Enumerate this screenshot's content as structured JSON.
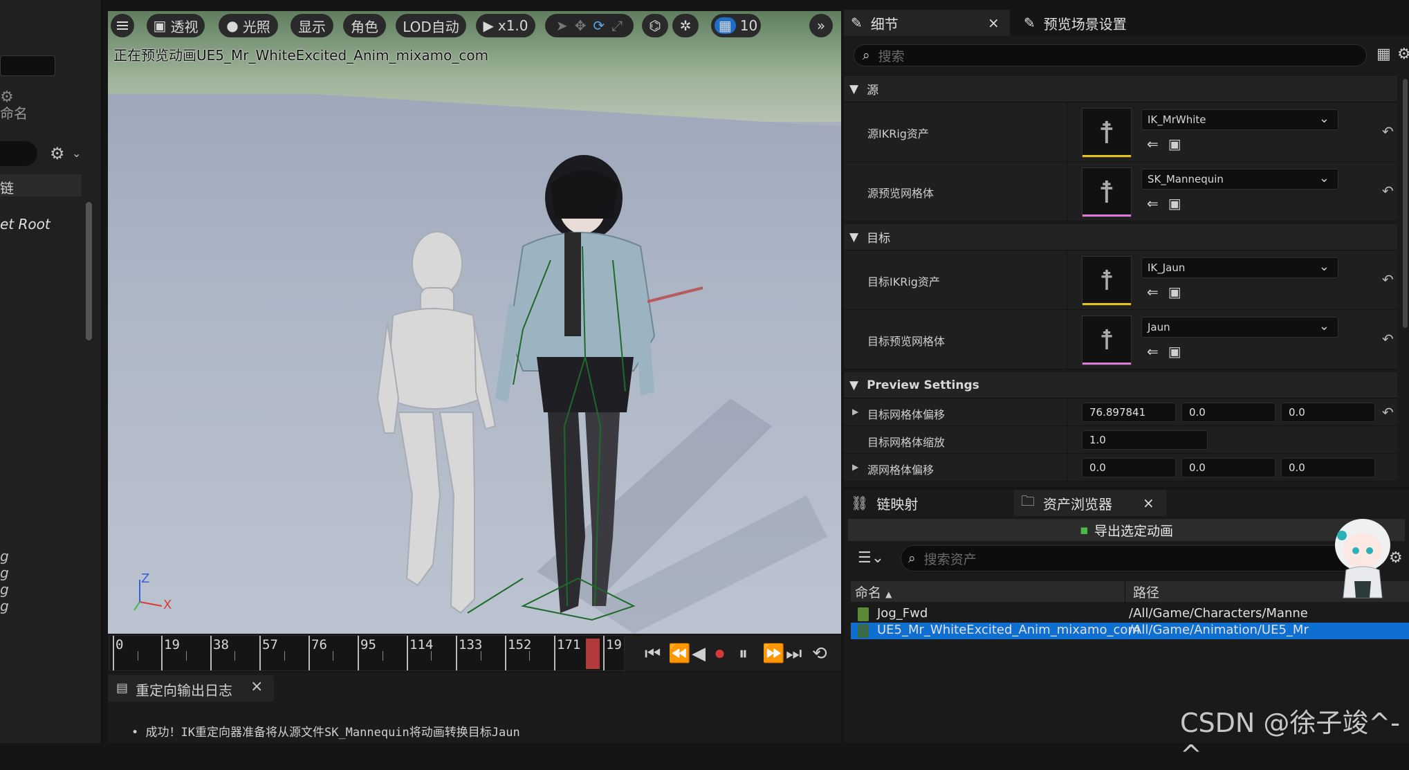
{
  "left": {
    "name_label": "命名",
    "chain_label": "链",
    "root_label": "et Root",
    "items": [
      "g",
      "g",
      "g",
      "g"
    ]
  },
  "viewport": {
    "menu_icon": "hamburger-icon",
    "perspective": "透视",
    "lighting": "光照",
    "show": "显示",
    "character": "角色",
    "lod": "LOD自动",
    "play_speed": "x1.0",
    "grid_value": "10",
    "preview_label": "正在预览动画UE5_Mr_WhiteExcited_Anim_mixamo_com",
    "axis_z": "Z",
    "axis_x": "X"
  },
  "timeline": {
    "ticks": [
      "0",
      "19",
      "38",
      "57",
      "76",
      "95",
      "114",
      "133",
      "152",
      "171",
      "19"
    ]
  },
  "log": {
    "tab_label": "重定向输出日志",
    "message": "成功！IK重定向器准备将从源文件SK_Mannequin将动画转换目标Jaun"
  },
  "details": {
    "tab_details": "细节",
    "tab_preview_settings": "预览场景设置",
    "search_placeholder": "搜索",
    "section_source": "源",
    "source_ik_label": "源IKRig资产",
    "source_ik_value": "IK_MrWhite",
    "source_mesh_label": "源预览网格体",
    "source_mesh_value": "SK_Mannequin",
    "section_target": "目标",
    "target_ik_label": "目标IKRig资产",
    "target_ik_value": "IK_Jaun",
    "target_mesh_label": "目标预览网格体",
    "target_mesh_value": "Jaun",
    "section_preview": "Preview Settings",
    "target_offset_label": "目标网格体偏移",
    "target_offset": [
      "76.897841",
      "0.0",
      "0.0"
    ],
    "target_scale_label": "目标网格体缩放",
    "target_scale": "1.0",
    "source_offset_label": "源网格体偏移",
    "source_offset": [
      "0.0",
      "0.0",
      "0.0"
    ]
  },
  "bottom": {
    "tab_chain_mapping": "链映射",
    "tab_asset_browser": "资产浏览器",
    "export_button": "导出选定动画",
    "search_placeholder": "搜索资产",
    "col_name": "命名",
    "col_path": "路径",
    "assets": [
      {
        "name": "Jog_Fwd",
        "path": "/All/Game/Characters/Manne"
      },
      {
        "name": "UE5_Mr_WhiteExcited_Anim_mixamo_com",
        "path": "/All/Game/Animation/UE5_Mr"
      }
    ]
  },
  "watermark": "CSDN @徐子竣^-^",
  "colors": {
    "accent_blue": "#0e6fd0",
    "playhead": "#b23a3a",
    "ik_bar": "#e8c21a",
    "mesh_bar": "#e07ad8"
  }
}
